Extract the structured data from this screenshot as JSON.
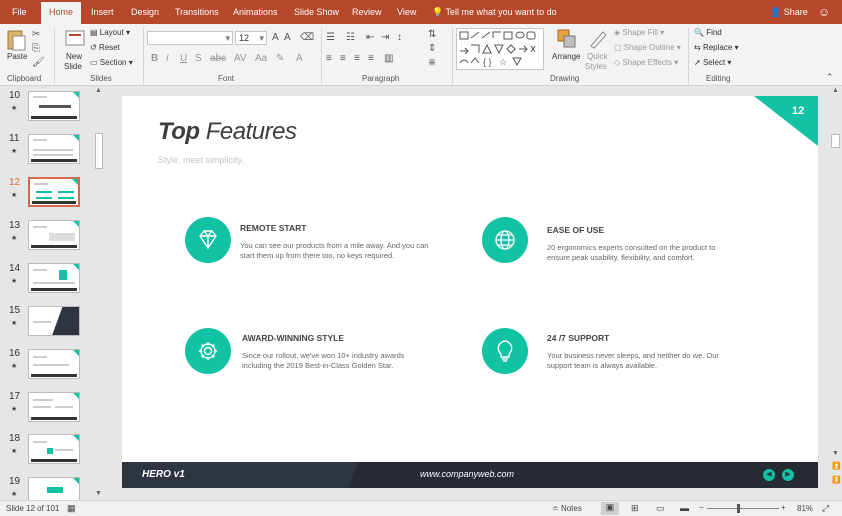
{
  "tabs": [
    {
      "label": "File"
    },
    {
      "label": "Home"
    },
    {
      "label": "Insert"
    },
    {
      "label": "Design"
    },
    {
      "label": "Transitions"
    },
    {
      "label": "Animations"
    },
    {
      "label": "Slide Show"
    },
    {
      "label": "Review"
    },
    {
      "label": "View"
    }
  ],
  "active_tab": "Home",
  "tell_me": "Tell me what you want to do",
  "share": "Share",
  "ribbon": {
    "clipboard": {
      "paste": "Paste",
      "label": "Clipboard"
    },
    "slides": {
      "new_slide_1": "New",
      "new_slide_2": "Slide",
      "layout": "Layout",
      "reset": "Reset",
      "section": "Section",
      "label": "Slides"
    },
    "font": {
      "font_name": "",
      "font_size": "12",
      "label": "Font"
    },
    "paragraph": {
      "label": "Paragraph"
    },
    "drawing": {
      "arrange": "Arrange",
      "quick_1": "Quick",
      "quick_2": "Styles",
      "shape_fill": "Shape Fill",
      "shape_outline": "Shape Outline",
      "shape_effects": "Shape Effects",
      "label": "Drawing"
    },
    "editing": {
      "find": "Find",
      "replace": "Replace",
      "select": "Select",
      "label": "Editing"
    }
  },
  "thumbnails": [
    {
      "num": "10",
      "star": "★"
    },
    {
      "num": "11",
      "star": "★"
    },
    {
      "num": "12",
      "star": "★"
    },
    {
      "num": "13",
      "star": "★"
    },
    {
      "num": "14",
      "star": "★"
    },
    {
      "num": "15",
      "star": "★"
    },
    {
      "num": "16",
      "star": "★"
    },
    {
      "num": "17",
      "star": "★"
    },
    {
      "num": "18",
      "star": "★"
    },
    {
      "num": "19",
      "star": "★"
    }
  ],
  "selected_slide": "12",
  "slide": {
    "number": "12",
    "title_bold": "Top",
    "title_light": "Features",
    "subtitle": "Style, meet simplicity.",
    "features": [
      {
        "title": "REMOTE START",
        "text1": "You can see our products from a mile away. And you can",
        "text2": "start them up from there too, no keys required.",
        "icon": "diamond-icon"
      },
      {
        "title": "EASE OF USE",
        "text1": "20 ergonomics experts consulted on the product to",
        "text2": "ensure peak usability, flexibility, and comfort.",
        "icon": "globe-icon"
      },
      {
        "title": "AWARD-WINNING STYLE",
        "text1": "Since our rollout, we've won 10+ industry awards",
        "text2": "including the 2019 Best-in-Class Golden Star.",
        "icon": "gear-icon"
      },
      {
        "title": "24 /7 SUPPORT",
        "text1": "Your business never sleeps, and neither do we. Our",
        "text2": "support team is always available.",
        "icon": "lightbulb-icon"
      }
    ],
    "footer_logo": "HERO v1",
    "footer_url": "www.companyweb.com"
  },
  "status": {
    "slide_of": "Slide 12 of 101",
    "notes": "Notes",
    "zoom": "81%"
  },
  "colors": {
    "accent": "#12c2a4",
    "tabbar": "#b7472a",
    "footer": "#2e3440"
  }
}
